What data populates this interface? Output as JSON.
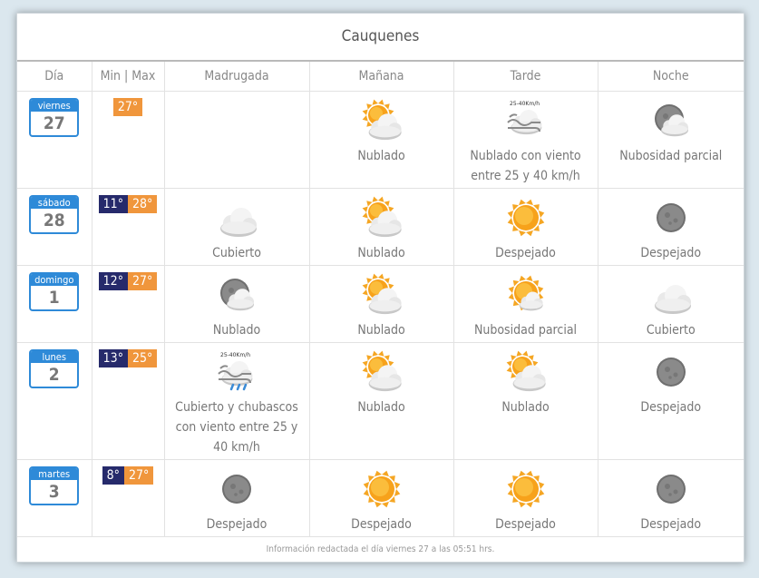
{
  "location": "Cauquenes",
  "headers": [
    "Día",
    "Min | Max",
    "Madrugada",
    "Mañana",
    "Tarde",
    "Noche"
  ],
  "days": [
    {
      "dayname": "viernes",
      "daynum": "27",
      "min": "",
      "max": "27°",
      "periods": [
        {
          "icon": "",
          "desc": ""
        },
        {
          "icon": "sun-cloud",
          "desc": "Nublado"
        },
        {
          "icon": "wind",
          "desc": "Nublado con viento entre 25 y 40 km/h"
        },
        {
          "icon": "moon-cloud",
          "desc": "Nubosidad parcial"
        }
      ]
    },
    {
      "dayname": "sábado",
      "daynum": "28",
      "min": "11°",
      "max": "28°",
      "periods": [
        {
          "icon": "cloud",
          "desc": "Cubierto"
        },
        {
          "icon": "sun-cloud",
          "desc": "Nublado"
        },
        {
          "icon": "sun",
          "desc": "Despejado"
        },
        {
          "icon": "moon",
          "desc": "Despejado"
        }
      ]
    },
    {
      "dayname": "domingo",
      "daynum": "1",
      "min": "12°",
      "max": "27°",
      "periods": [
        {
          "icon": "moon-cloud",
          "desc": "Nublado"
        },
        {
          "icon": "sun-cloud",
          "desc": "Nublado"
        },
        {
          "icon": "sun-cloud-small",
          "desc": "Nubosidad parcial"
        },
        {
          "icon": "cloud",
          "desc": "Cubierto"
        }
      ]
    },
    {
      "dayname": "lunes",
      "daynum": "2",
      "min": "13°",
      "max": "25°",
      "periods": [
        {
          "icon": "wind-rain",
          "desc": "Cubierto y chubascos con viento entre 25 y 40 km/h"
        },
        {
          "icon": "sun-cloud",
          "desc": "Nublado"
        },
        {
          "icon": "sun-cloud",
          "desc": "Nublado"
        },
        {
          "icon": "moon",
          "desc": "Despejado"
        }
      ]
    },
    {
      "dayname": "martes",
      "daynum": "3",
      "min": "8°",
      "max": "27°",
      "periods": [
        {
          "icon": "moon",
          "desc": "Despejado"
        },
        {
          "icon": "sun",
          "desc": "Despejado"
        },
        {
          "icon": "sun",
          "desc": "Despejado"
        },
        {
          "icon": "moon",
          "desc": "Despejado"
        }
      ]
    }
  ],
  "wind_label": "25-40Km/h",
  "footer": "Información redactada el día viernes 27 a las 05:51 hrs.",
  "colors": {
    "day_blue": "#2e8ad8",
    "min_bg": "#262a6b",
    "max_bg": "#f0963c"
  }
}
